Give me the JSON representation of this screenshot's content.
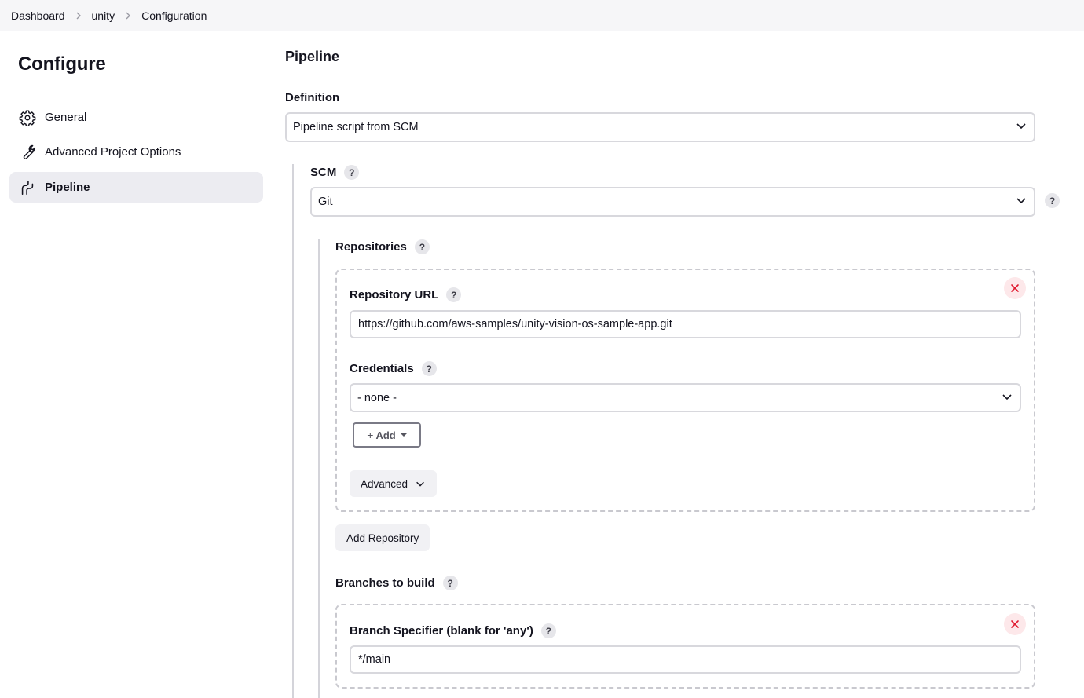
{
  "breadcrumb": {
    "items": [
      "Dashboard",
      "unity",
      "Configuration"
    ]
  },
  "sidebar": {
    "title": "Configure",
    "items": [
      {
        "label": "General",
        "icon": "gear-icon"
      },
      {
        "label": "Advanced Project Options",
        "icon": "wrench-icon"
      },
      {
        "label": "Pipeline",
        "icon": "pipeline-icon",
        "active": true
      }
    ]
  },
  "pipeline": {
    "section_title": "Pipeline",
    "definition_label": "Definition",
    "definition_value": "Pipeline script from SCM",
    "scm_label": "SCM",
    "scm_value": "Git",
    "help_glyph": "?",
    "repositories": {
      "label": "Repositories",
      "repository_url_label": "Repository URL",
      "repository_url_value": "https://github.com/aws-samples/unity-vision-os-sample-app.git",
      "credentials_label": "Credentials",
      "credentials_value": "- none -",
      "add_button": {
        "plus": "+",
        "label": "Add"
      },
      "advanced_button": "Advanced",
      "add_repository_button": "Add Repository"
    },
    "branches": {
      "label": "Branches to build",
      "branch_specifier_label": "Branch Specifier (blank for 'any')",
      "branch_specifier_value": "*/main"
    }
  },
  "colors": {
    "accent_close": "#e0182e",
    "border": "#d8d8dd",
    "active_bg": "#ececf1"
  }
}
